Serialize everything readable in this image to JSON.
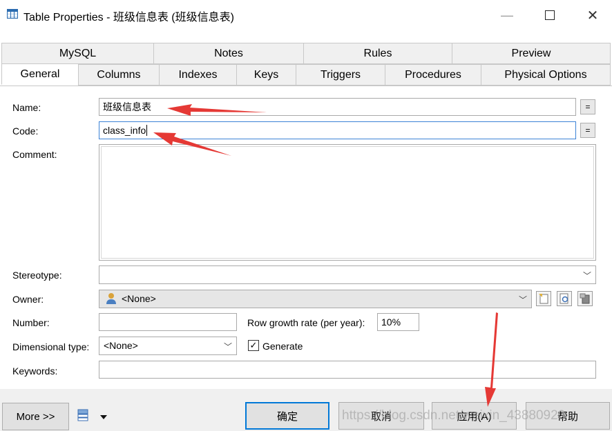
{
  "window": {
    "title": "Table Properties - 班级信息表 (班级信息表)",
    "minimize": "—",
    "close": "✕"
  },
  "tabs_row1": [
    "MySQL",
    "Notes",
    "Rules",
    "Preview"
  ],
  "tabs_row2": [
    "General",
    "Columns",
    "Indexes",
    "Keys",
    "Triggers",
    "Procedures",
    "Physical Options"
  ],
  "active_tab": "General",
  "form": {
    "name_label": "Name:",
    "name_value": "班级信息表",
    "code_label": "Code:",
    "code_value": "class_info",
    "eq_label": "=",
    "comment_label": "Comment:",
    "comment_value": "",
    "stereotype_label": "Stereotype:",
    "stereotype_value": "",
    "owner_label": "Owner:",
    "owner_value": "<None>",
    "number_label": "Number:",
    "number_value": "",
    "growth_label": "Row growth rate (per year):",
    "growth_value": "10%",
    "dimensional_label": "Dimensional type:",
    "dimensional_value": "<None>",
    "generate_label": "Generate",
    "generate_checked": true,
    "keywords_label": "Keywords:",
    "keywords_value": ""
  },
  "bottom": {
    "more_label": "More >>",
    "ok_label": "确定",
    "cancel_label": "取消",
    "apply_label": "应用(A)",
    "help_label": "帮助"
  },
  "watermark": "https://blog.csdn.net/weixin_43880920",
  "colors": {
    "arrow": "#e53935",
    "focus_border": "#3b82d6",
    "default_button_border": "#0078d7"
  }
}
